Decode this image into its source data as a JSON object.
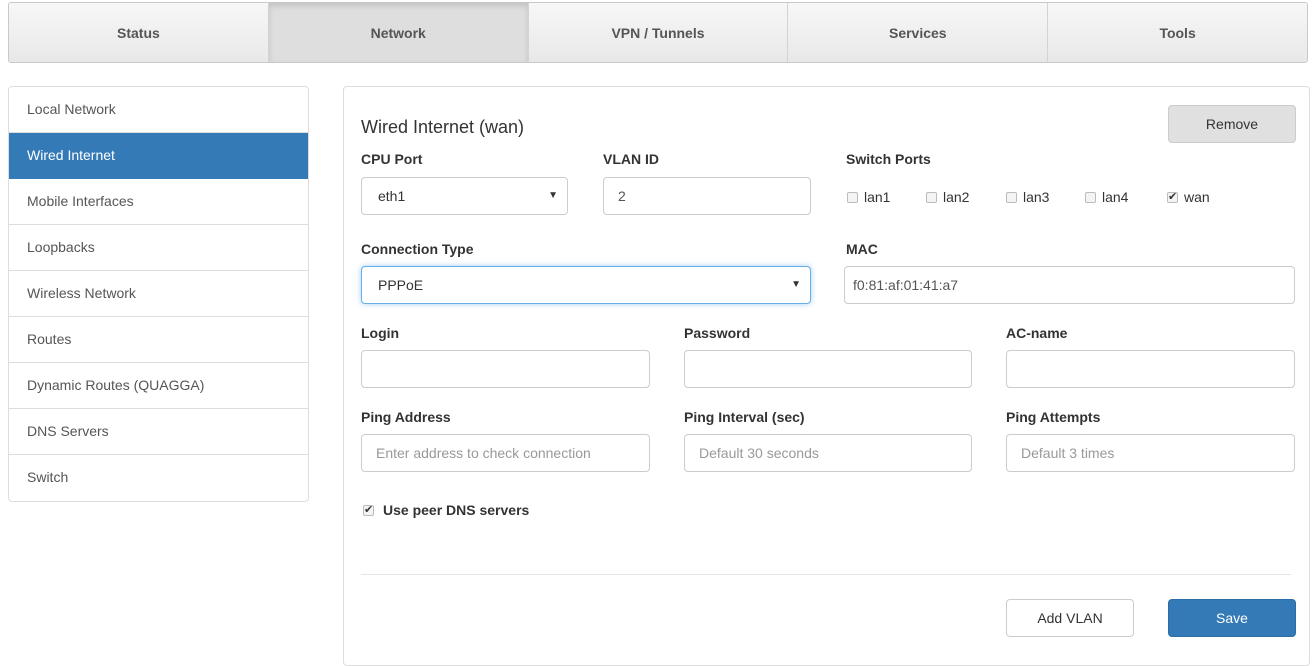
{
  "topnav": {
    "tabs": [
      {
        "label": "Status"
      },
      {
        "label": "Network"
      },
      {
        "label": "VPN / Tunnels"
      },
      {
        "label": "Services"
      },
      {
        "label": "Tools"
      }
    ]
  },
  "sidebar": {
    "items": [
      {
        "label": "Local Network"
      },
      {
        "label": "Wired Internet"
      },
      {
        "label": "Mobile Interfaces"
      },
      {
        "label": "Loopbacks"
      },
      {
        "label": "Wireless Network"
      },
      {
        "label": "Routes"
      },
      {
        "label": "Dynamic Routes (QUAGGA)"
      },
      {
        "label": "DNS Servers"
      },
      {
        "label": "Switch"
      }
    ]
  },
  "panel": {
    "title": "Wired Internet (wan)",
    "remove_label": "Remove",
    "cpu_port": {
      "label": "CPU Port",
      "value": "eth1"
    },
    "vlan_id": {
      "label": "VLAN ID",
      "value": "2"
    },
    "switch_ports": {
      "label": "Switch Ports",
      "ports": [
        {
          "label": "lan1",
          "checked": false
        },
        {
          "label": "lan2",
          "checked": false
        },
        {
          "label": "lan3",
          "checked": false
        },
        {
          "label": "lan4",
          "checked": false
        },
        {
          "label": "wan",
          "checked": true
        }
      ]
    },
    "connection_type": {
      "label": "Connection Type",
      "value": "PPPoE"
    },
    "mac": {
      "label": "MAC",
      "value": "f0:81:af:01:41:a7"
    },
    "login": {
      "label": "Login",
      "value": ""
    },
    "password": {
      "label": "Password",
      "value": ""
    },
    "ac_name": {
      "label": "AC-name",
      "value": ""
    },
    "ping_address": {
      "label": "Ping Address",
      "placeholder": "Enter address to check connection"
    },
    "ping_interval": {
      "label": "Ping Interval (sec)",
      "placeholder": "Default 30 seconds"
    },
    "ping_attempts": {
      "label": "Ping Attempts",
      "placeholder": "Default 3 times"
    },
    "peer_dns": {
      "label": "Use peer DNS servers",
      "checked": true
    },
    "add_vlan_label": "Add VLAN",
    "save_label": "Save"
  }
}
